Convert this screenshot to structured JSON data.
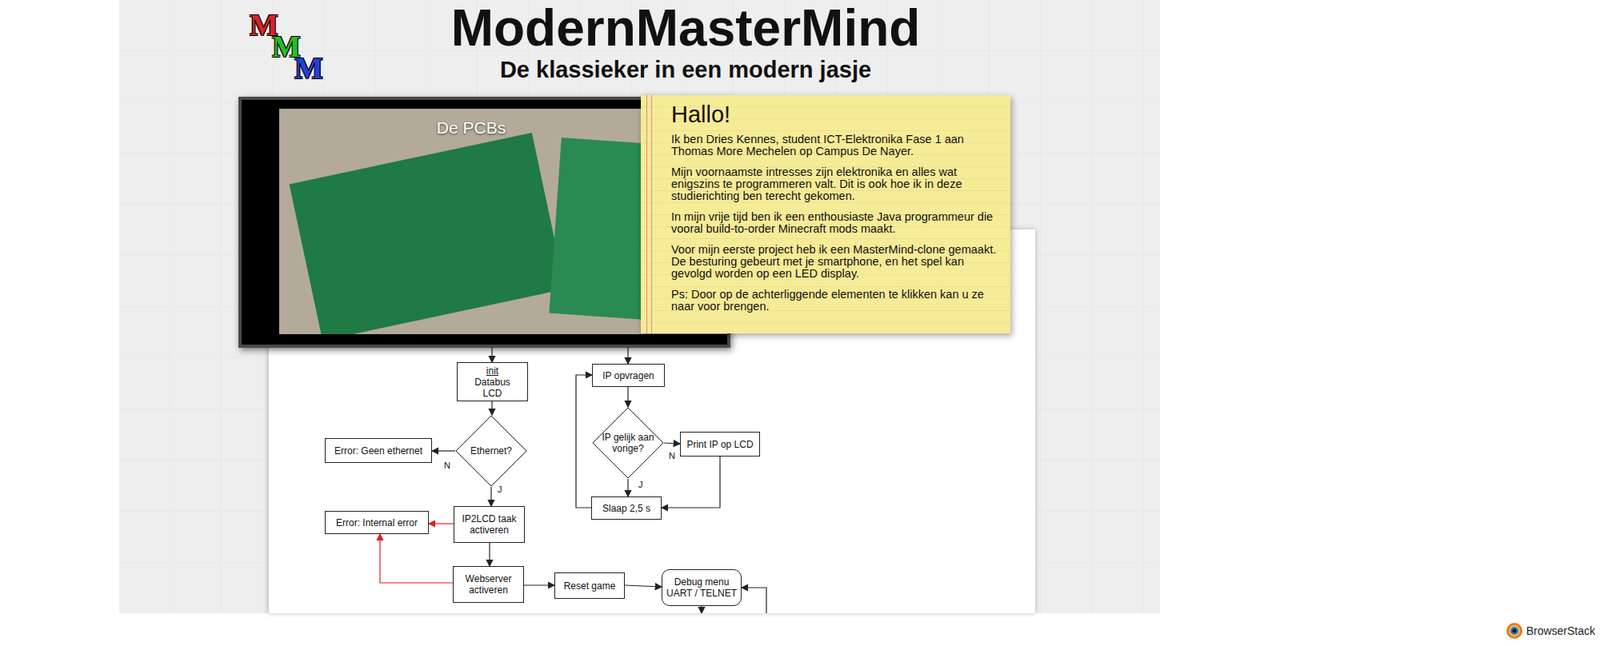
{
  "header": {
    "logo": [
      {
        "letter": "M",
        "color": "#d62424"
      },
      {
        "letter": "M",
        "color": "#22c122"
      },
      {
        "letter": "M",
        "color": "#2540d6"
      }
    ],
    "title": "ModernMasterMind",
    "subtitle": "De klassieker in een modern jasje"
  },
  "photo": {
    "caption": "De PCBs"
  },
  "note": {
    "title": "Hallo!",
    "paragraphs": [
      "Ik ben Dries Kennes, student ICT-Elektronika Fase 1 aan Thomas More Mechelen op Campus De Nayer.",
      "Mijn voornaamste intresses zijn elektronika en alles wat enigszins te programmeren valt. Dit is ook hoe ik in deze studierichting ben terecht gekomen.",
      "In mijn vrije tijd ben ik een enthousiaste Java programmeur die vooral build-to-order Minecraft mods maakt.",
      "Voor mijn eerste project heb ik een MasterMind-clone gemaakt. De besturing gebeurt met je smartphone, en het spel kan gevolgd worden op een LED display.",
      "Ps: Door op de achterliggende elementen te klikken kan u ze naar voor brengen."
    ]
  },
  "flowchart": {
    "nodes": [
      {
        "lines": [
          "init",
          "Databus",
          "LCD"
        ],
        "kind": "box",
        "underline_first": true
      },
      {
        "lines": [
          "Ethernet?"
        ],
        "kind": "diamond",
        "underline_first": false
      },
      {
        "lines": [
          "Error: Geen ethernet"
        ],
        "kind": "box",
        "underline_first": false
      },
      {
        "lines": [
          "IP2LCD taak",
          "activeren"
        ],
        "kind": "box",
        "underline_first": false
      },
      {
        "lines": [
          "Error: Internal error"
        ],
        "kind": "box",
        "underline_first": false
      },
      {
        "lines": [
          "Webserver",
          "activeren"
        ],
        "kind": "box",
        "underline_first": false
      },
      {
        "lines": [
          "Reset game"
        ],
        "kind": "box",
        "underline_first": false
      },
      {
        "lines": [
          "Debug menu",
          "UART / TELNET"
        ],
        "kind": "rounded",
        "underline_first": false
      },
      {
        "lines": [
          "IP opvragen"
        ],
        "kind": "box",
        "underline_first": false
      },
      {
        "lines": [
          "IP gelijk aan",
          "vorige?"
        ],
        "kind": "diamond",
        "underline_first": false
      },
      {
        "lines": [
          "Print IP op LCD"
        ],
        "kind": "box",
        "underline_first": false
      },
      {
        "lines": [
          "Slaap 2,5 s"
        ],
        "kind": "box",
        "underline_first": false
      }
    ],
    "labels": [
      "N",
      "J",
      "N",
      "J"
    ]
  },
  "badge": {
    "text": "BrowserStack"
  }
}
